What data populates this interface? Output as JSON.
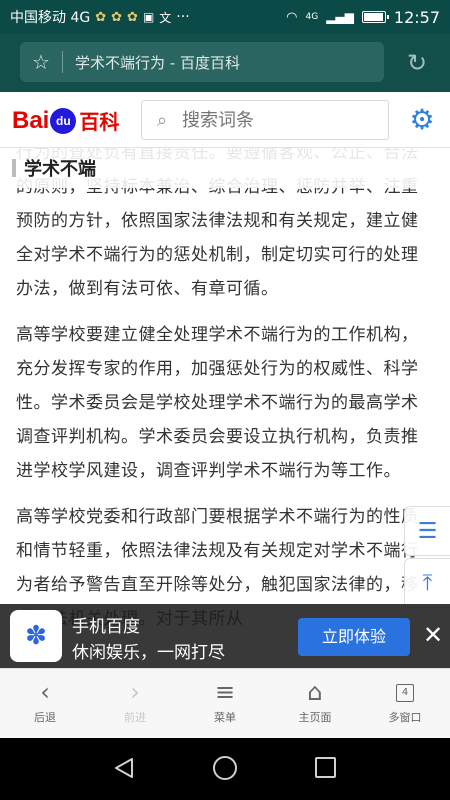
{
  "status_bar": {
    "carrier": "中国移动 4G",
    "time": "12:57",
    "network_badge": "4G",
    "battery_level": 0.85,
    "left_glyphs": [
      "pay-icon",
      "pay-icon",
      "pay-icon",
      "sms-icon",
      "translate-icon",
      "more-icon"
    ],
    "right_icons": [
      "wifi-icon",
      "signal-icon",
      "battery-icon"
    ]
  },
  "browser": {
    "url_text": "学术不端行为 - 百度百科"
  },
  "header": {
    "logo_bai": "Bai",
    "logo_du": "du",
    "logo_baike": "百科",
    "search_placeholder": "搜索词条"
  },
  "article": {
    "sticky_title": "学术不端",
    "overlay_fragment": "行为的查处负有直接责任。要遵循客观",
    "paragraphs": [
      "行为的查处负有直接责任。要遵循客观、公正、合法的原则，坚持标本兼治、综合治理、惩防并举、注重预防的方针，依照国家法律法规和有关规定，建立健全对学术不端行为的惩处机制，制定切实可行的处理办法，做到有法可依、有章可循。",
      "高等学校要建立健全处理学术不端行为的工作机构，充分发挥专家的作用，加强惩处行为的权威性、科学性。学术委员会是学校处理学术不端行为的最高学术调查评判机构。学术委员会要设立执行机构，负责推进学校学风建设，调查评判学术不端行为等工作。",
      "高等学校党委和行政部门要根据学术不端行为的性质和情节轻重，依照法律法规及有关规定对学术不端行为者给予警告直至开除等处分，触犯国家法律的，移送司法机关处理。对于其所从"
    ]
  },
  "banner": {
    "title": "手机百度",
    "subtitle": "休闲娱乐，一网打尽",
    "button": "立即体验"
  },
  "toolbar": {
    "back": "后退",
    "forward": "前进",
    "menu": "菜单",
    "home": "主页面",
    "windows": "多窗口",
    "window_count": "4"
  }
}
